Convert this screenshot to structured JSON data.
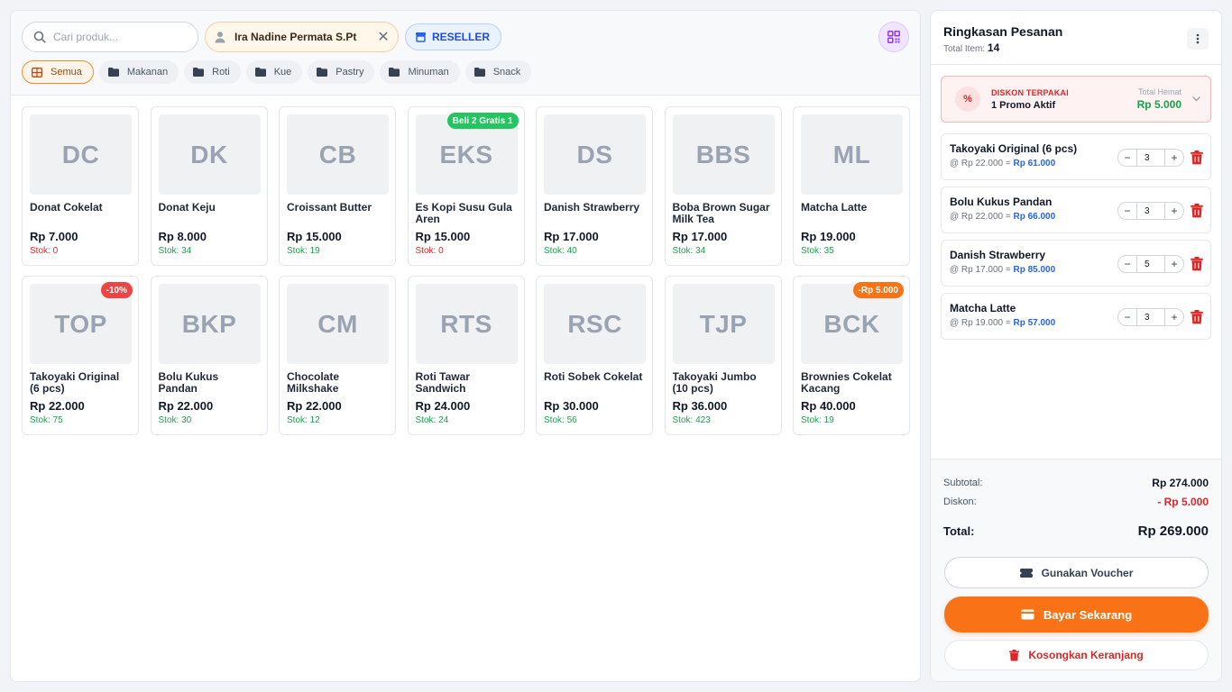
{
  "search": {
    "placeholder": "Cari produk..."
  },
  "customer": {
    "name": "Ira Nadine Permata S.Pt"
  },
  "reseller": {
    "label": "RESELLER"
  },
  "categories": [
    {
      "label": "Semua",
      "active": true
    },
    {
      "label": "Makanan"
    },
    {
      "label": "Roti"
    },
    {
      "label": "Kue"
    },
    {
      "label": "Pastry"
    },
    {
      "label": "Minuman"
    },
    {
      "label": "Snack"
    }
  ],
  "products": [
    {
      "initials": "DC",
      "name": "Donat Cokelat",
      "price": "Rp 7.000",
      "stock": "Stok: 0",
      "stock_status": "out",
      "badge": ""
    },
    {
      "initials": "DK",
      "name": "Donat Keju",
      "price": "Rp 8.000",
      "stock": "Stok: 34",
      "stock_status": "ok",
      "badge": ""
    },
    {
      "initials": "CB",
      "name": "Croissant Butter",
      "price": "Rp 15.000",
      "stock": "Stok: 19",
      "stock_status": "ok",
      "badge": ""
    },
    {
      "initials": "EKS",
      "name": "Es Kopi Susu Gula Aren",
      "price": "Rp 15.000",
      "stock": "Stok: 0",
      "stock_status": "out",
      "badge": "Beli 2 Gratis 1",
      "badge_color": "green"
    },
    {
      "initials": "DS",
      "name": "Danish Strawberry",
      "price": "Rp 17.000",
      "stock": "Stok: 40",
      "stock_status": "ok",
      "badge": ""
    },
    {
      "initials": "BBS",
      "name": "Boba Brown Sugar Milk Tea",
      "price": "Rp 17.000",
      "stock": "Stok: 34",
      "stock_status": "ok",
      "badge": ""
    },
    {
      "initials": "ML",
      "name": "Matcha Latte",
      "price": "Rp 19.000",
      "stock": "Stok: 35",
      "stock_status": "ok",
      "badge": ""
    },
    {
      "initials": "TOP",
      "name": "Takoyaki Original (6 pcs)",
      "price": "Rp 22.000",
      "stock": "Stok: 75",
      "stock_status": "ok",
      "badge": "-10%",
      "badge_color": "red"
    },
    {
      "initials": "BKP",
      "name": "Bolu Kukus Pandan",
      "price": "Rp 22.000",
      "stock": "Stok: 30",
      "stock_status": "ok",
      "badge": ""
    },
    {
      "initials": "CM",
      "name": "Chocolate Milkshake",
      "price": "Rp 22.000",
      "stock": "Stok: 12",
      "stock_status": "ok",
      "badge": ""
    },
    {
      "initials": "RTS",
      "name": "Roti Tawar Sandwich",
      "price": "Rp 24.000",
      "stock": "Stok: 24",
      "stock_status": "ok",
      "badge": ""
    },
    {
      "initials": "RSC",
      "name": "Roti Sobek Cokelat",
      "price": "Rp 30.000",
      "stock": "Stok: 56",
      "stock_status": "ok",
      "badge": ""
    },
    {
      "initials": "TJP",
      "name": "Takoyaki Jumbo (10 pcs)",
      "price": "Rp 36.000",
      "stock": "Stok: 423",
      "stock_status": "ok",
      "badge": ""
    },
    {
      "initials": "BCK",
      "name": "Brownies Cokelat Kacang",
      "price": "Rp 40.000",
      "stock": "Stok: 19",
      "stock_status": "ok",
      "badge": "-Rp 5.000",
      "badge_color": "orange"
    }
  ],
  "order": {
    "title": "Ringkasan Pesanan",
    "total_items_label": "Total Item:",
    "total_items": "14",
    "promo": {
      "label": "DISKON TERPAKAI",
      "value": "1 Promo Aktif",
      "saving_label": "Total Hemat",
      "saving_value": "Rp 5.000"
    },
    "items": [
      {
        "name": "Takoyaki Original (6 pcs)",
        "unit": "@ Rp 22.000 =",
        "total": "Rp 61.000",
        "qty": "3"
      },
      {
        "name": "Bolu Kukus Pandan",
        "unit": "@ Rp 22.000 =",
        "total": "Rp 66.000",
        "qty": "3"
      },
      {
        "name": "Danish Strawberry",
        "unit": "@ Rp 17.000 =",
        "total": "Rp 85.000",
        "qty": "5"
      },
      {
        "name": "Matcha Latte",
        "unit": "@ Rp 19.000 =",
        "total": "Rp 57.000",
        "qty": "3"
      }
    ],
    "subtotal_label": "Subtotal:",
    "subtotal": "Rp 274.000",
    "discount_label": "Diskon:",
    "discount": "- Rp 5.000",
    "total_label": "Total:",
    "total": "Rp 269.000",
    "voucher_label": "Gunakan Voucher",
    "pay_label": "Bayar Sekarang",
    "clear_label": "Kosongkan Keranjang"
  },
  "colors": {
    "accent": "#f97316",
    "discount": "#dc2626",
    "saving": "#16a34a",
    "link": "#2563eb"
  }
}
